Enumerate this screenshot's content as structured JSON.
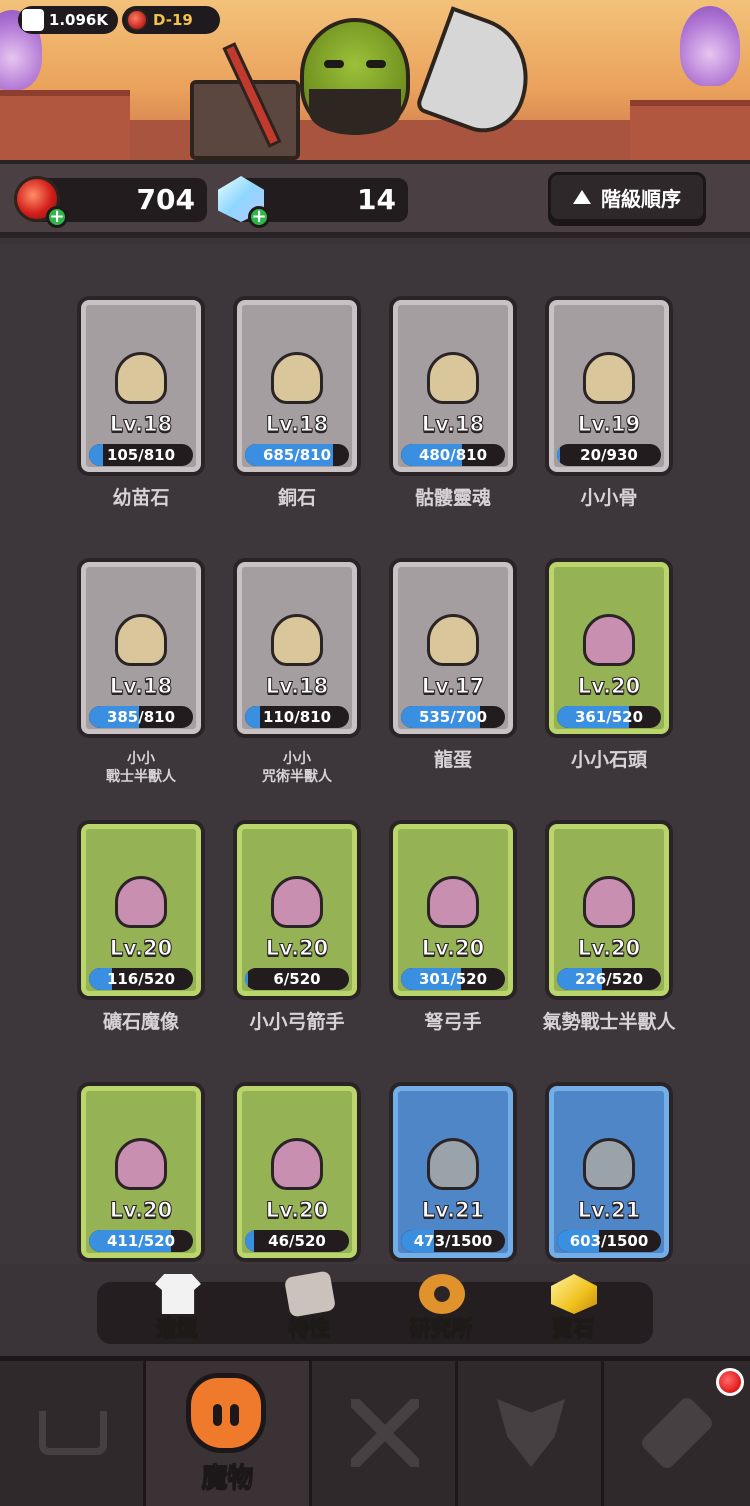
{
  "top": {
    "likes": "1.096K",
    "stage": "D-19"
  },
  "resources": {
    "gems": "704",
    "crystals": "14",
    "sort_label": "階級順序"
  },
  "monsters": [
    {
      "level": "Lv.18",
      "progress_text": "105/810",
      "progress": 0.13,
      "name": "幼苗石",
      "tier": "gray"
    },
    {
      "level": "Lv.18",
      "progress_text": "685/810",
      "progress": 0.85,
      "name": "銅石",
      "tier": "gray"
    },
    {
      "level": "Lv.18",
      "progress_text": "480/810",
      "progress": 0.59,
      "name": "骷髏靈魂",
      "tier": "gray"
    },
    {
      "level": "Lv.19",
      "progress_text": "20/930",
      "progress": 0.02,
      "name": "小小骨",
      "tier": "gray"
    },
    {
      "level": "Lv.18",
      "progress_text": "385/810",
      "progress": 0.48,
      "name_line1": "小小",
      "name_line2": "戰士半獸人",
      "tier": "gray"
    },
    {
      "level": "Lv.18",
      "progress_text": "110/810",
      "progress": 0.14,
      "name_line1": "小小",
      "name_line2": "咒術半獸人",
      "tier": "gray"
    },
    {
      "level": "Lv.17",
      "progress_text": "535/700",
      "progress": 0.76,
      "name": "龍蛋",
      "tier": "gray"
    },
    {
      "level": "Lv.20",
      "progress_text": "361/520",
      "progress": 0.69,
      "name": "小小石頭",
      "tier": "green"
    },
    {
      "level": "Lv.20",
      "progress_text": "116/520",
      "progress": 0.22,
      "name": "礦石魔像",
      "tier": "green"
    },
    {
      "level": "Lv.20",
      "progress_text": "6/520",
      "progress": 0.01,
      "name": "小小弓箭手",
      "tier": "green"
    },
    {
      "level": "Lv.20",
      "progress_text": "301/520",
      "progress": 0.58,
      "name": "弩弓手",
      "tier": "green"
    },
    {
      "level": "Lv.20",
      "progress_text": "226/520",
      "progress": 0.43,
      "name": "氣勢戰士半獸人",
      "tier": "green"
    },
    {
      "level": "Lv.20",
      "progress_text": "411/520",
      "progress": 0.79,
      "name": "",
      "tier": "green"
    },
    {
      "level": "Lv.20",
      "progress_text": "46/520",
      "progress": 0.09,
      "name": "",
      "tier": "green"
    },
    {
      "level": "Lv.21",
      "progress_text": "473/1500",
      "progress": 0.32,
      "name": "",
      "tier": "blue"
    },
    {
      "level": "Lv.21",
      "progress_text": "603/1500",
      "progress": 0.4,
      "name": "",
      "tier": "blue"
    }
  ],
  "subtabs": [
    {
      "label": "造型",
      "icon": "shirt-icon"
    },
    {
      "label": "特性",
      "icon": "scroll-icon"
    },
    {
      "label": "研究所",
      "icon": "gear-icon"
    },
    {
      "label": "寶石",
      "icon": "gem-icon"
    }
  ],
  "nav": {
    "active_label": "魔物",
    "items": [
      "cart-icon",
      "monster-icon",
      "swords-icon",
      "rank-icon",
      "ticket-icon"
    ]
  },
  "colors": {
    "gray_card": "#a49ea0",
    "green_card": "#95b255",
    "blue_card": "#4f86c8",
    "progress_fill": "#3a8fe0",
    "accent_orange": "#f07a2c"
  }
}
